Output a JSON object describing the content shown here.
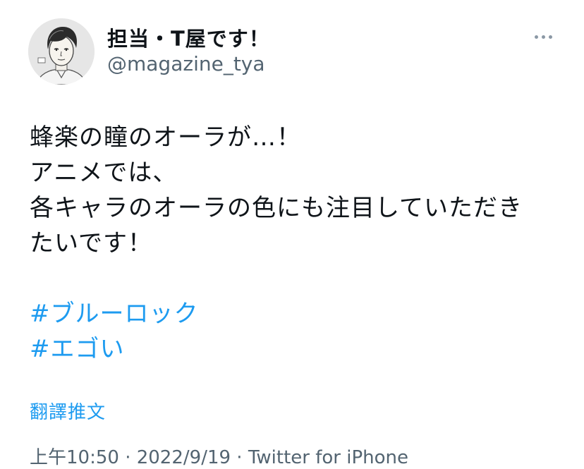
{
  "author": {
    "display_name": "担当・T屋です！",
    "handle": "@magazine_tya"
  },
  "tweet": {
    "lines": [
      "蜂楽の瞳のオーラが…！",
      "アニメでは、",
      "各キャラのオーラの色にも注目していただき",
      "たいです！"
    ],
    "hashtags": [
      "#ブルーロック",
      "#エゴい"
    ],
    "translate_label": "翻譯推文",
    "meta": "上午10:50 · 2022/9/19 · Twitter for iPhone"
  },
  "colors": {
    "link": "#1d9bf0",
    "secondary_text": "#536471",
    "primary_text": "#0f1419"
  },
  "icons": {
    "more": "more-horizontal-icon"
  }
}
